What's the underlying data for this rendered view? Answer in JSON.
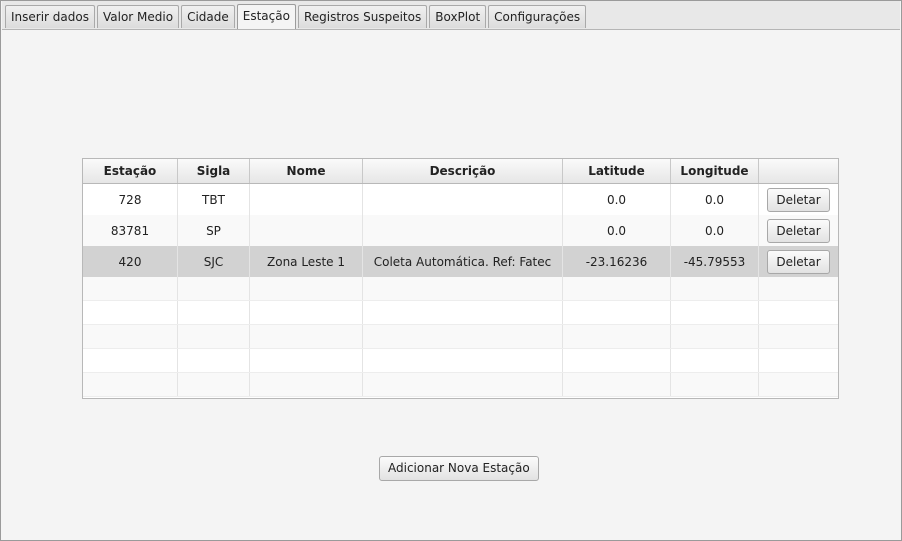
{
  "tabs": [
    {
      "label": "Inserir dados",
      "active": false
    },
    {
      "label": "Valor Medio",
      "active": false
    },
    {
      "label": "Cidade",
      "active": false
    },
    {
      "label": "Estação",
      "active": true
    },
    {
      "label": "Registros Suspeitos",
      "active": false
    },
    {
      "label": "BoxPlot",
      "active": false
    },
    {
      "label": "Configurações",
      "active": false
    }
  ],
  "table": {
    "columns": [
      "Estação",
      "Sigla",
      "Nome",
      "Descrição",
      "Latitude",
      "Longitude",
      ""
    ],
    "rows": [
      {
        "estacao": "728",
        "sigla": "TBT",
        "nome": "",
        "descricao": "",
        "latitude": "0.0",
        "longitude": "0.0",
        "action": "Deletar"
      },
      {
        "estacao": "83781",
        "sigla": "SP",
        "nome": "",
        "descricao": "",
        "latitude": "0.0",
        "longitude": "0.0",
        "action": "Deletar"
      },
      {
        "estacao": "420",
        "sigla": "SJC",
        "nome": "Zona Leste 1",
        "descricao": "Coleta Automática. Ref: Fatec",
        "latitude": "-23.16236",
        "longitude": "-45.79553",
        "action": "Deletar"
      }
    ],
    "selected_row": 2
  },
  "add_button_label": "Adicionar Nova Estação"
}
